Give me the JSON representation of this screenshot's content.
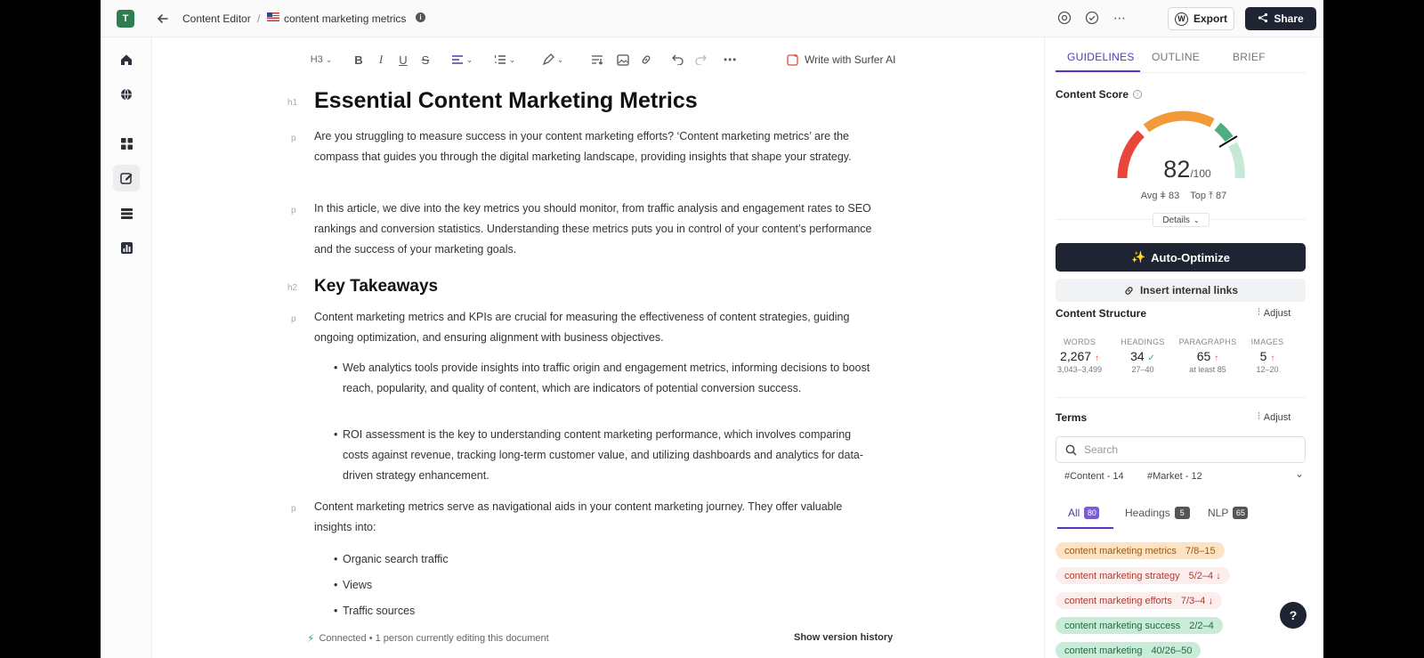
{
  "topbar": {
    "workspace_initial": "T",
    "breadcrumb_root": "Content Editor",
    "breadcrumb_sep": "/",
    "document_title": "content marketing metrics",
    "export_label": "Export",
    "share_label": "Share"
  },
  "toolbar": {
    "heading_level": "H3",
    "bold": "B",
    "italic": "I",
    "underline": "U",
    "strike": "S",
    "ai_label": "Write with Surfer AI"
  },
  "doc": {
    "h1_tag": "h1",
    "title": "Essential Content Marketing Metrics",
    "p_tag": "p",
    "h2_tag": "h2",
    "intro": "Are you struggling to measure success in your content marketing efforts? ‘Content marketing metrics’ are the compass that guides you through the digital marketing landscape, providing insights that shape your strategy.",
    "intro2": "In this article, we dive into the key metrics you should monitor, from traffic analysis and engagement rates to SEO rankings and conversion statistics. Understanding these metrics puts you in control of your content’s performance and the success of your marketing goals.",
    "takeaways_heading": "Key Takeaways",
    "takeaways_p": "Content marketing metrics and KPIs are crucial for measuring the effectiveness of content strategies, guiding ongoing optimization, and ensuring alignment with business objectives.",
    "bullet1": "Web analytics tools provide insights into traffic origin and engagement metrics, informing decisions to boost reach, popularity, and quality of content, which are indicators of potential conversion success.",
    "bullet2": "ROI assessment is the key to understanding content marketing performance, which involves comparing costs against revenue, tracking long-term customer value, and utilizing dashboards and analytics for data-driven strategy enhancement.",
    "nav_p": "Content marketing metrics serve as navigational aids in your content marketing journey. They offer valuable insights into:",
    "list": [
      "Organic search traffic",
      "Views",
      "Traffic sources"
    ]
  },
  "footer": {
    "status": "Connected • 1 person currently editing this document",
    "history": "Show version history"
  },
  "panel": {
    "tabs": [
      "GUIDELINES",
      "OUTLINE",
      "BRIEF"
    ],
    "score_title": "Content Score",
    "score": "82",
    "score_max": "/100",
    "avg_label": "Avg",
    "avg_value": "83",
    "top_label": "Top",
    "top_value": "87",
    "details": "Details",
    "auto_optimize": "Auto-Optimize",
    "insert_links": "Insert internal links",
    "structure_title": "Content Structure",
    "adjust": "Adjust",
    "stats": [
      {
        "label": "WORDS",
        "value": "2,267",
        "range": "3,043–3,499",
        "trend": "↑"
      },
      {
        "label": "HEADINGS",
        "value": "34",
        "range": "27–40",
        "trend": "✓"
      },
      {
        "label": "PARAGRAPHS",
        "value": "65",
        "range": "at least 85",
        "trend": "↑"
      },
      {
        "label": "IMAGES",
        "value": "5",
        "range": "12–20",
        "trend": "↑"
      }
    ],
    "terms_title": "Terms",
    "search_placeholder": "Search",
    "chips": [
      "#Content - 14",
      "#Market - 12"
    ],
    "filters": [
      {
        "label": "All",
        "count": "80"
      },
      {
        "label": "Headings",
        "count": "5"
      },
      {
        "label": "NLP",
        "count": "65"
      }
    ],
    "terms": [
      {
        "text": "content marketing metrics",
        "count": "7/8–15",
        "trend": ""
      },
      {
        "text": "content marketing strategy",
        "count": "5/2–4",
        "trend": "↓"
      },
      {
        "text": "content marketing efforts",
        "count": "7/3–4",
        "trend": "↓"
      },
      {
        "text": "content marketing success",
        "count": "2/2–4",
        "trend": ""
      },
      {
        "text": "content marketing",
        "count": "40/26–50",
        "trend": ""
      }
    ],
    "help": "?"
  },
  "colors": {
    "accent": "#5a34b8",
    "dark": "#1f2433",
    "gauge_red": "#e8463a",
    "gauge_orange": "#f29a37",
    "gauge_green": "#4caf7d"
  }
}
